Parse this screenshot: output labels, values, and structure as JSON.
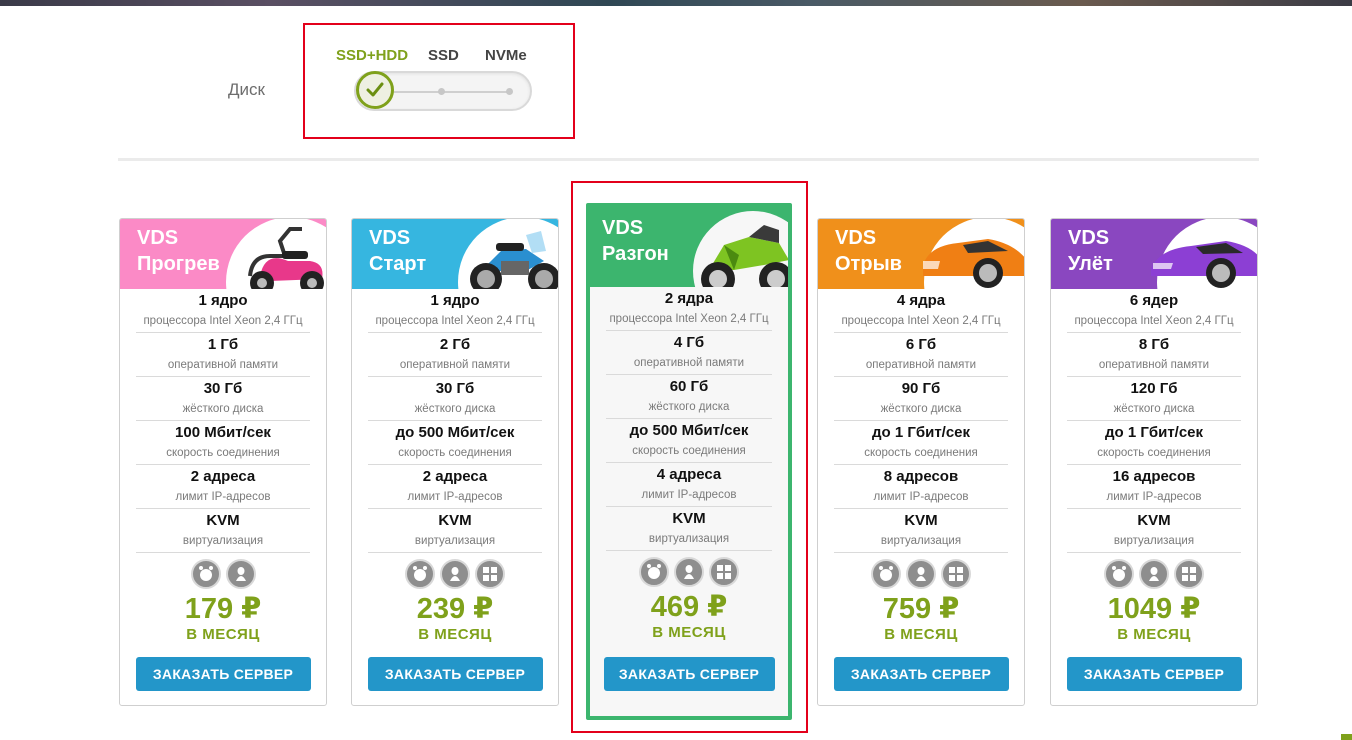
{
  "disk": {
    "label": "Диск",
    "options": [
      "SSD+HDD",
      "SSD",
      "NVMe"
    ],
    "selected_index": 0
  },
  "colors": {
    "accent_green": "#7fa11b",
    "featured_border": "#3cb56e",
    "button_blue": "#2396c9",
    "highlight_red": "#e3001b"
  },
  "plans": [
    {
      "title_line1": "VDS",
      "title_line2": "Прогрев",
      "header_color": "#fb8ac6",
      "vehicle_icon": "scooter-icon",
      "cpu": "1 ядро",
      "cpu_label": "процессора Intel Xeon 2,4 ГГц",
      "ram": "1 Гб",
      "ram_label": "оперативной памяти",
      "disk": "30 Гб",
      "disk_label": "жёсткого диска",
      "speed": "100 Мбит/сек",
      "speed_label": "скорость соединения",
      "ip": "2 адреса",
      "ip_label": "лимит IP-адресов",
      "virt": "KVM",
      "virt_label": "виртуализация",
      "os_icons": [
        "freebsd-icon",
        "linux-icon"
      ],
      "price": "179 ₽",
      "per": "В МЕСЯЦ",
      "button": "ЗАКАЗАТЬ СЕРВЕР"
    },
    {
      "title_line1": "VDS",
      "title_line2": "Старт",
      "header_color": "#36b6e0",
      "vehicle_icon": "touring-motorcycle-icon",
      "cpu": "1 ядро",
      "cpu_label": "процессора Intel Xeon 2,4 ГГц",
      "ram": "2 Гб",
      "ram_label": "оперативной памяти",
      "disk": "30 Гб",
      "disk_label": "жёсткого диска",
      "speed": "до 500 Мбит/сек",
      "speed_label": "скорость соединения",
      "ip": "2 адреса",
      "ip_label": "лимит IP-адресов",
      "virt": "KVM",
      "virt_label": "виртуализация",
      "os_icons": [
        "freebsd-icon",
        "linux-icon",
        "windows-icon"
      ],
      "price": "239 ₽",
      "per": "В МЕСЯЦ",
      "button": "ЗАКАЗАТЬ СЕРВЕР"
    },
    {
      "title_line1": "VDS",
      "title_line2": "Разгон",
      "header_color": "#3cb56e",
      "vehicle_icon": "sport-motorcycle-icon",
      "cpu": "2 ядра",
      "cpu_label": "процессора Intel Xeon 2,4 ГГц",
      "ram": "4 Гб",
      "ram_label": "оперативной памяти",
      "disk": "60 Гб",
      "disk_label": "жёсткого диска",
      "speed": "до 500 Мбит/сек",
      "speed_label": "скорость соединения",
      "ip": "4 адреса",
      "ip_label": "лимит IP-адресов",
      "virt": "KVM",
      "virt_label": "виртуализация",
      "os_icons": [
        "freebsd-icon",
        "linux-icon",
        "windows-icon"
      ],
      "price": "469 ₽",
      "per": "В МЕСЯЦ",
      "button": "ЗАКАЗАТЬ СЕРВЕР"
    },
    {
      "title_line1": "VDS",
      "title_line2": "Отрыв",
      "header_color": "#f0901b",
      "vehicle_icon": "sports-car-icon",
      "cpu": "4 ядра",
      "cpu_label": "процессора Intel Xeon 2,4 ГГц",
      "ram": "6 Гб",
      "ram_label": "оперативной памяти",
      "disk": "90 Гб",
      "disk_label": "жёсткого диска",
      "speed": "до 1 Гбит/сек",
      "speed_label": "скорость соединения",
      "ip": "8 адресов",
      "ip_label": "лимит IP-адресов",
      "virt": "KVM",
      "virt_label": "виртуализация",
      "os_icons": [
        "freebsd-icon",
        "linux-icon",
        "windows-icon"
      ],
      "price": "759 ₽",
      "per": "В МЕСЯЦ",
      "button": "ЗАКАЗАТЬ СЕРВЕР"
    },
    {
      "title_line1": "VDS",
      "title_line2": "Улёт",
      "header_color": "#8a47c0",
      "vehicle_icon": "supercar-icon",
      "cpu": "6 ядер",
      "cpu_label": "процессора Intel Xeon 2,4 ГГц",
      "ram": "8 Гб",
      "ram_label": "оперативной памяти",
      "disk": "120 Гб",
      "disk_label": "жёсткого диска",
      "speed": "до 1 Гбит/сек",
      "speed_label": "скорость соединения",
      "ip": "16 адресов",
      "ip_label": "лимит IP-адресов",
      "virt": "KVM",
      "virt_label": "виртуализация",
      "os_icons": [
        "freebsd-icon",
        "linux-icon",
        "windows-icon"
      ],
      "price": "1049 ₽",
      "per": "В МЕСЯЦ",
      "button": "ЗАКАЗАТЬ СЕРВЕР"
    }
  ]
}
